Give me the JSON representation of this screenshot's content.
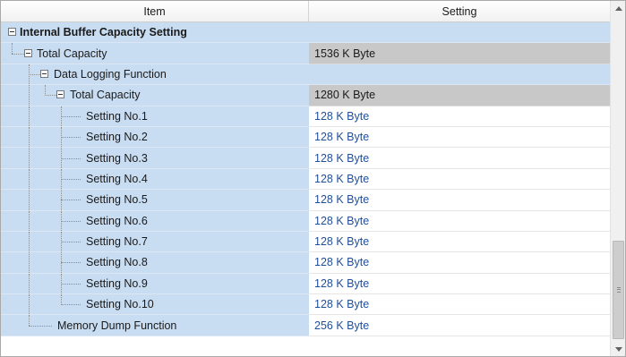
{
  "header": {
    "item": "Item",
    "setting": "Setting"
  },
  "rows": {
    "0": {
      "label": "Internal Buffer Capacity Setting",
      "value": ""
    },
    "1": {
      "label": "Total Capacity",
      "value": "1536 K Byte"
    },
    "2": {
      "label": "Data Logging Function",
      "value": ""
    },
    "3": {
      "label": "Total Capacity",
      "value": "1280 K Byte"
    },
    "4": {
      "label": "Setting No.1",
      "value": "128 K Byte"
    },
    "5": {
      "label": "Setting No.2",
      "value": "128 K Byte"
    },
    "6": {
      "label": "Setting No.3",
      "value": "128 K Byte"
    },
    "7": {
      "label": "Setting No.4",
      "value": "128 K Byte"
    },
    "8": {
      "label": "Setting No.5",
      "value": "128 K Byte"
    },
    "9": {
      "label": "Setting No.6",
      "value": "128 K Byte"
    },
    "10": {
      "label": "Setting No.7",
      "value": "128 K Byte"
    },
    "11": {
      "label": "Setting No.8",
      "value": "128 K Byte"
    },
    "12": {
      "label": "Setting No.9",
      "value": "128 K Byte"
    },
    "13": {
      "label": "Setting No.10",
      "value": "128 K Byte"
    },
    "14": {
      "label": "Memory Dump Function",
      "value": "256 K Byte"
    }
  },
  "colors": {
    "item_bg": "#c9ddf2",
    "readonly_bg": "#c8c8c8",
    "value_text": "#1f4f9a"
  },
  "icons": {
    "expand": "collapse-minus-icon",
    "scroll_up": "arrow-up-icon",
    "scroll_down": "arrow-down-icon"
  }
}
